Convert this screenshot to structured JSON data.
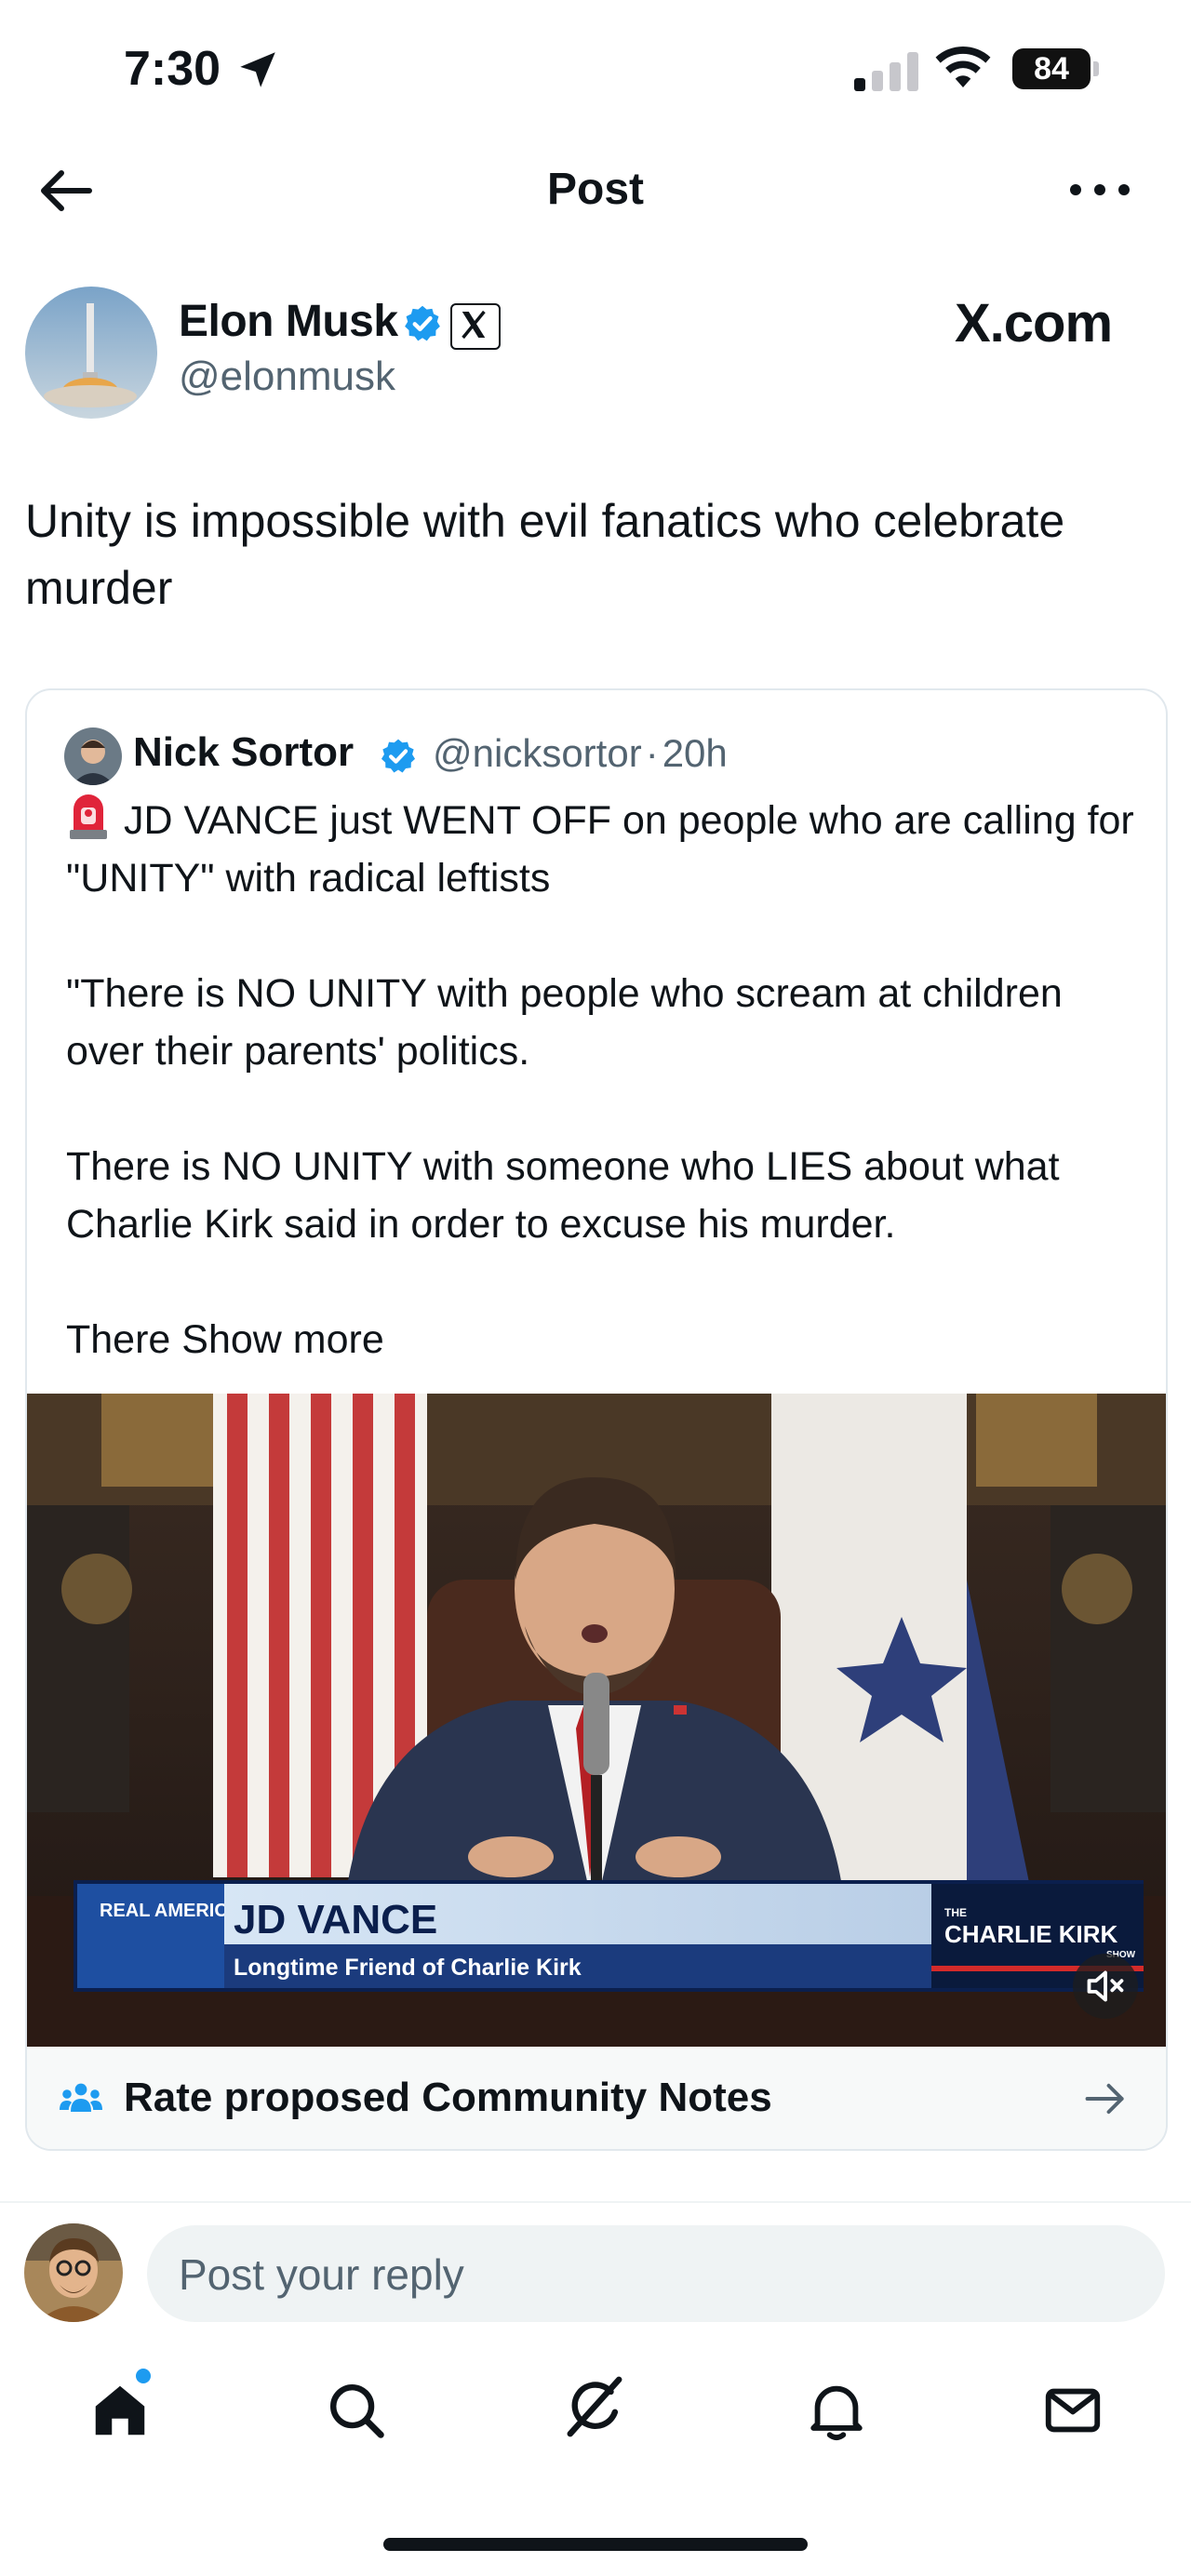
{
  "status_bar": {
    "time": "7:30",
    "battery": "84"
  },
  "header": {
    "title": "Post"
  },
  "post": {
    "author_name": "Elon Musk",
    "author_handle": "@elonmusk",
    "watermark": "X.com",
    "text": "Unity is impossible with evil fanatics who celebrate murder"
  },
  "quoted_post": {
    "author_name": "Nick Sortor",
    "author_handle": "@nicksortor",
    "separator": "·",
    "age": "20h",
    "text": "JD VANCE just WENT OFF on people who are calling for \"UNITY\" with radical leftists\n\n\"There is NO UNITY with people who scream at children over their parents' politics.\n\nThere is NO UNITY with someone who LIES about what Charlie Kirk said in order to excuse his murder.\n\nThere ",
    "show_more": "Show more",
    "video": {
      "network_logo": "REAL AMERICA'S VOICE",
      "lower_third_name": "JD VANCE",
      "lower_third_subtitle": "Longtime Friend of Charlie Kirk",
      "show_logo_top": "THE",
      "show_logo": "CHARLIE KIRK",
      "show_logo_bottom": "SHOW"
    }
  },
  "community_notes": {
    "label": "Rate proposed Community Notes"
  },
  "reply": {
    "placeholder": "Post your reply"
  },
  "colors": {
    "accent": "#1d9bf0",
    "text": "#0f1419",
    "muted": "#536471"
  },
  "icons": {
    "nav": [
      "home-icon",
      "search-icon",
      "grok-icon",
      "notifications-icon",
      "messages-icon"
    ]
  }
}
